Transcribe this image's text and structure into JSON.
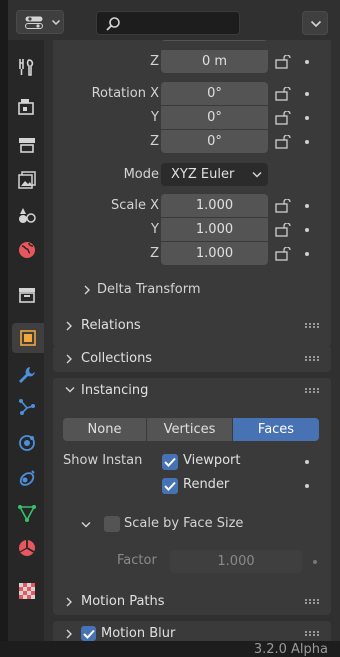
{
  "header": {
    "editor_type_icon": "properties-editor-icon",
    "search_placeholder": "",
    "filter_icon": "chevron-down-icon"
  },
  "tabs": [
    {
      "name": "tool",
      "icon": "tool-icon",
      "color": "#d4d4d4"
    },
    {
      "name": "render",
      "icon": "render-icon",
      "color": "#d4d4d4"
    },
    {
      "name": "output",
      "icon": "output-icon",
      "color": "#d4d4d4"
    },
    {
      "name": "view-layer",
      "icon": "view-layer-icon",
      "color": "#d4d4d4"
    },
    {
      "name": "scene",
      "icon": "scene-icon",
      "color": "#d4d4d4"
    },
    {
      "name": "world",
      "icon": "world-icon",
      "color": "#e8575d"
    },
    {
      "name": "collection",
      "icon": "collection-icon",
      "color": "#d4d4d4"
    },
    {
      "name": "object",
      "icon": "object-icon",
      "color": "#f5a63d",
      "active": true
    },
    {
      "name": "modifiers",
      "icon": "wrench-icon",
      "color": "#4d8fdc"
    },
    {
      "name": "particles",
      "icon": "particles-icon",
      "color": "#4d8fdc"
    },
    {
      "name": "physics",
      "icon": "physics-icon",
      "color": "#4d8fdc"
    },
    {
      "name": "constraints",
      "icon": "constraints-icon",
      "color": "#4d8fdc"
    },
    {
      "name": "data",
      "icon": "mesh-data-icon",
      "color": "#37c26d"
    },
    {
      "name": "material",
      "icon": "material-icon",
      "color": "#e8575d"
    },
    {
      "name": "texture",
      "icon": "texture-icon",
      "color": "#d4d4d4"
    }
  ],
  "transform": {
    "location_z_label": "Z",
    "location_z_value": "0 m",
    "rotation_x_label": "Rotation X",
    "rotation_x_value": "0°",
    "rotation_y_label": "Y",
    "rotation_y_value": "0°",
    "rotation_z_label": "Z",
    "rotation_z_value": "0°",
    "mode_label": "Mode",
    "mode_value": "XYZ Euler",
    "scale_x_label": "Scale X",
    "scale_x_value": "1.000",
    "scale_y_label": "Y",
    "scale_y_value": "1.000",
    "scale_z_label": "Z",
    "scale_z_value": "1.000",
    "delta_transform_label": "Delta Transform"
  },
  "panels": {
    "relations": "Relations",
    "collections": "Collections",
    "instancing": "Instancing",
    "motion_paths": "Motion Paths",
    "motion_blur": "Motion Blur"
  },
  "instancing": {
    "options": [
      "None",
      "Vertices",
      "Faces"
    ],
    "selected": "Faces",
    "show_label": "Show Instan",
    "viewport_label": "Viewport",
    "viewport_checked": true,
    "render_label": "Render",
    "render_checked": true,
    "scale_by_face_label": "Scale by Face Size",
    "scale_by_face_checked": false,
    "factor_label": "Factor",
    "factor_value": "1.000"
  },
  "status": {
    "version": "3.2.0 Alpha"
  },
  "colors": {
    "accent": "#4772b3",
    "panel": "#3a3a3a",
    "field": "#545454"
  }
}
